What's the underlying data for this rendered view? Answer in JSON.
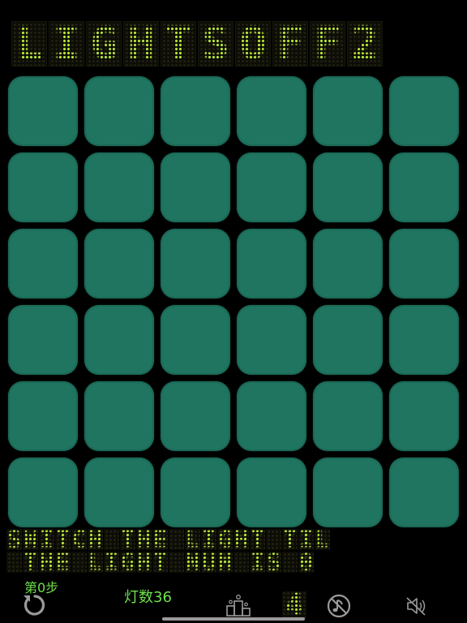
{
  "title": "LIGHTSOFF2",
  "board": {
    "rows": 6,
    "cols": 6,
    "cells": [
      [
        0,
        0,
        0,
        0,
        0,
        0
      ],
      [
        0,
        0,
        0,
        0,
        0,
        0
      ],
      [
        0,
        0,
        0,
        0,
        0,
        0
      ],
      [
        0,
        0,
        0,
        0,
        0,
        0
      ],
      [
        0,
        0,
        0,
        0,
        0,
        0
      ],
      [
        0,
        0,
        0,
        0,
        0,
        0
      ]
    ],
    "light_color": "#1f7560"
  },
  "message": {
    "line1": "SWITCH THE LIGHT TIL",
    "line2": " THE LIGHT NUM IS 0"
  },
  "toolbar": {
    "step_label": "第0步",
    "lights_count_label": "灯数36",
    "level": "4",
    "restart_icon": "restart-icon",
    "rank_icon": "podium-icon",
    "music_icon": "music-off-icon",
    "sound_icon": "speaker-muted-icon"
  },
  "colors": {
    "led_on": "#b9e83a",
    "status_text": "#6ee04a",
    "background": "#000000"
  }
}
